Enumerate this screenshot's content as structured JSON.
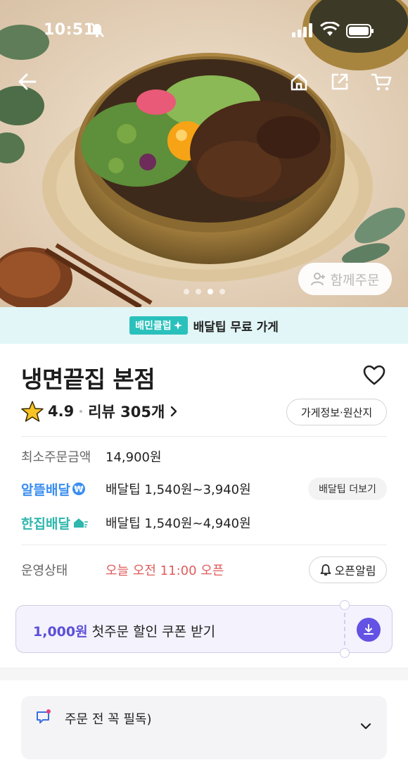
{
  "status_bar": {
    "time": "10:51"
  },
  "hero": {
    "image_description_icon": "bibimbap-bowl-image",
    "pager_count": 4,
    "pager_active_index": 2,
    "together_order_label": "함께주문"
  },
  "club_banner": {
    "badge": "배민클럽",
    "text": "배달팁 무료 가게"
  },
  "store": {
    "name": "냉면끝집 본점",
    "rating": "4.9",
    "review_label": "리뷰 305개",
    "info_button": "가게정보·원산지"
  },
  "details": {
    "min_order_label": "최소주문금액",
    "min_order_value": "14,900원",
    "al_brand": "알뜰배달",
    "al_value": "배달팁 1,540원~3,940원",
    "tip_more_label": "배달팁 더보기",
    "han_brand": "한집배달",
    "han_value": "배달팁 1,540원~4,940원",
    "status_label": "운영상태",
    "status_value": "오늘 오전 11:00 오픈",
    "open_alarm_label": "오픈알림"
  },
  "coupon": {
    "amount": "1,000원",
    "text": " 첫주문 할인 쿠폰 받기"
  },
  "notice": {
    "text": "주문 전 꼭 필독)"
  },
  "colors": {
    "club_badge": "#2ac1bc",
    "club_banner_bg": "#e2f6f7",
    "coupon_accent": "#5c4fd7",
    "open_status": "#e05c5c",
    "al_brand": "#3a8ef0",
    "han_brand": "#2fb6ad"
  }
}
